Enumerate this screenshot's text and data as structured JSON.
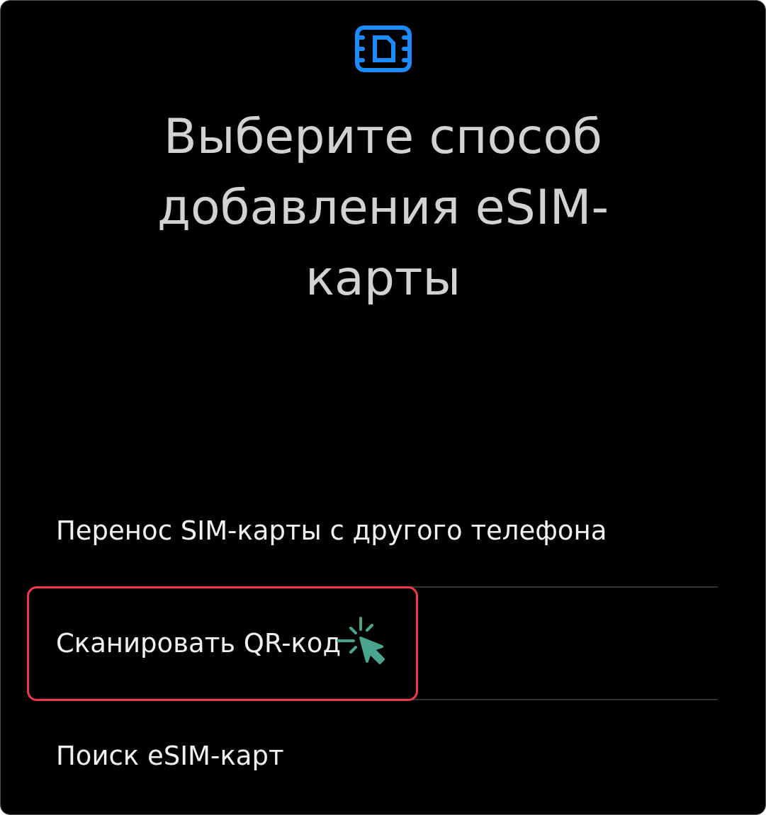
{
  "title": "Выберите способ добавления eSIM-карты",
  "options": [
    {
      "label": "Перенос SIM-карты с другого телефона",
      "highlighted": false
    },
    {
      "label": "Сканировать QR-код",
      "highlighted": true
    },
    {
      "label": "Поиск eSIM-карт",
      "highlighted": false
    }
  ]
}
